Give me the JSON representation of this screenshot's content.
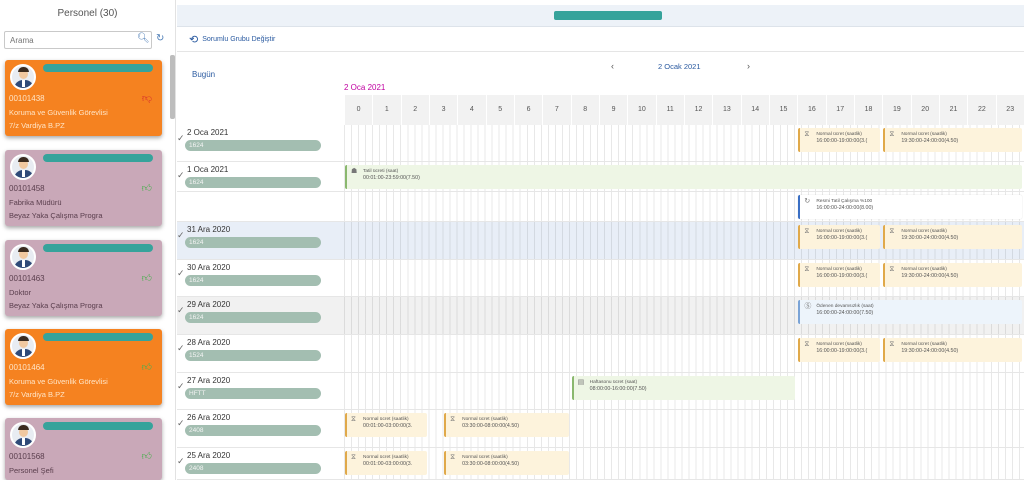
{
  "panel": {
    "title": "Personel (30)",
    "search_placeholder": "Arama"
  },
  "cards": [
    {
      "id": "00101438",
      "job": "Koruma ve Güvenlik Görevlisi",
      "role": "7/z Vardiya B.PZ",
      "color": "orange",
      "thumb": "down"
    },
    {
      "id": "00101458",
      "job": "Fabrika Müdürü",
      "role": "Beyaz Yaka Çalışma Progra",
      "color": "pink",
      "thumb": "up"
    },
    {
      "id": "00101463",
      "job": "Doktor",
      "role": "Beyaz Yaka Çalışma Progra",
      "color": "pink",
      "thumb": "up"
    },
    {
      "id": "00101464",
      "job": "Koruma ve Güvenlik Görevlisi",
      "role": "7/z Vardiya B.PZ",
      "color": "orange",
      "thumb": "up"
    },
    {
      "id": "00101568",
      "job": "Personel Şefi",
      "role": "",
      "color": "pink",
      "thumb": "up"
    }
  ],
  "toolbar": {
    "change_group": "Sorumlu Grubu Değiştir"
  },
  "calendar": {
    "today": "Bugün",
    "nav_date": "2 Ocak 2021",
    "sub_date": "2 Oca 2021",
    "nav_prev": "‹",
    "nav_next": "›"
  },
  "hours": [
    "0",
    "1",
    "2",
    "3",
    "4",
    "5",
    "6",
    "7",
    "8",
    "9",
    "10",
    "11",
    "12",
    "13",
    "14",
    "15",
    "16",
    "17",
    "18",
    "19",
    "20",
    "21",
    "22",
    "23"
  ],
  "rows": [
    {
      "date": "2 Oca 2021",
      "code": "1624"
    },
    {
      "date": "1 Oca 2021",
      "code": "1624"
    },
    {
      "date": "",
      "code": ""
    },
    {
      "date": "31 Ara 2020",
      "code": "1624"
    },
    {
      "date": "30 Ara 2020",
      "code": "1624"
    },
    {
      "date": "29 Ara 2020",
      "code": "1624"
    },
    {
      "date": "28 Ara 2020",
      "code": "1524"
    },
    {
      "date": "27 Ara 2020",
      "code": "HFTT"
    },
    {
      "date": "26 Ara 2020",
      "code": "2408"
    },
    {
      "date": "25 Ara 2020",
      "code": "2408"
    }
  ],
  "events": [
    {
      "row": 0,
      "start": 16,
      "end": 19.0,
      "title": "Normal ücret (saatlik)",
      "time": "16:00:00-19:00:00(3.(",
      "color": "yellow",
      "icon": "clock-coin-icon"
    },
    {
      "row": 0,
      "start": 19.0,
      "end": 24,
      "title": "Normal ücret (saatlik)",
      "time": "19:30:00-24:00:00(4.50)",
      "color": "yellow",
      "icon": "clock-coin-icon"
    },
    {
      "row": 1,
      "start": 0,
      "end": 24,
      "title": "Tatil ücreti (saat)",
      "time": "00:01:00-23:59:00(7.50)",
      "color": "green",
      "icon": "holiday-icon"
    },
    {
      "row": 2,
      "start": 16,
      "end": 24,
      "title": "Resmi Tatil Çalışma %100",
      "time": "16:00:00-24:00:00(8.00)",
      "color": "blue",
      "icon": "refresh-icon"
    },
    {
      "row": 3,
      "start": 16,
      "end": 19.0,
      "title": "Normal ücret (saatlik)",
      "time": "16:00:00-19:00:00(3.(",
      "color": "yellow",
      "icon": "clock-coin-icon"
    },
    {
      "row": 3,
      "start": 19.0,
      "end": 24,
      "title": "Normal ücret (saatlik)",
      "time": "19:30:00-24:00:00(4.50)",
      "color": "yellow",
      "icon": "clock-coin-icon"
    },
    {
      "row": 4,
      "start": 16,
      "end": 19.0,
      "title": "Normal ücret (saatlik)",
      "time": "16:00:00-19:00:00(3.(",
      "color": "yellow",
      "icon": "clock-coin-icon"
    },
    {
      "row": 4,
      "start": 19.0,
      "end": 24,
      "title": "Normal ücret (saatlik)",
      "time": "19:30:00-24:00:00(4.50)",
      "color": "yellow",
      "icon": "clock-coin-icon"
    },
    {
      "row": 5,
      "start": 16,
      "end": 24,
      "title": "Ödenen devamsızlık (saat)",
      "time": "16:00:00-24:00:00(7.50)",
      "color": "lblue",
      "icon": "coin-icon"
    },
    {
      "row": 6,
      "start": 16,
      "end": 19.0,
      "title": "Normal ücret (saatlik)",
      "time": "16:00:00-19:00:00(3.(",
      "color": "yellow",
      "icon": "clock-coin-icon"
    },
    {
      "row": 6,
      "start": 19.0,
      "end": 24,
      "title": "Normal ücret (saatlik)",
      "time": "19:30:00-24:00:00(4.50)",
      "color": "yellow",
      "icon": "clock-coin-icon"
    },
    {
      "row": 7,
      "start": 8,
      "end": 16,
      "title": "Haftasonu ücret (saat)",
      "time": "08:00:00-16:00:00(7.50)",
      "color": "green",
      "icon": "weekend-icon"
    },
    {
      "row": 8,
      "start": 0,
      "end": 3.0,
      "title": "Normal ücret (saatlik)",
      "time": "00:01:00-03:00:00(3.",
      "color": "yellow",
      "icon": "clock-coin-icon"
    },
    {
      "row": 8,
      "start": 3.5,
      "end": 8,
      "title": "Normal ücret (saatlik)",
      "time": "03:30:00-08:00:00(4.50)",
      "color": "yellow",
      "icon": "clock-coin-icon"
    },
    {
      "row": 9,
      "start": 0,
      "end": 3.0,
      "title": "Normal ücret (saatlik)",
      "time": "00:01:00-03:00:00(3.",
      "color": "yellow",
      "icon": "clock-coin-icon"
    },
    {
      "row": 9,
      "start": 3.5,
      "end": 8,
      "title": "Normal ücret (saatlik)",
      "time": "03:30:00-08:00:00(4.50)",
      "color": "yellow",
      "icon": "clock-coin-icon"
    }
  ],
  "icons": {
    "search": "search-icon",
    "refresh": "refresh-icon",
    "group": "group-change-icon",
    "check": "check-icon",
    "thumbs_up": "thumbs-up-icon",
    "thumbs_down": "thumbs-down-icon"
  },
  "colors": {
    "orange": "#f58220",
    "pink": "#c9a8b8",
    "teal": "#36a39b",
    "link": "#2a5aa0",
    "subdate": "#c000a0"
  }
}
